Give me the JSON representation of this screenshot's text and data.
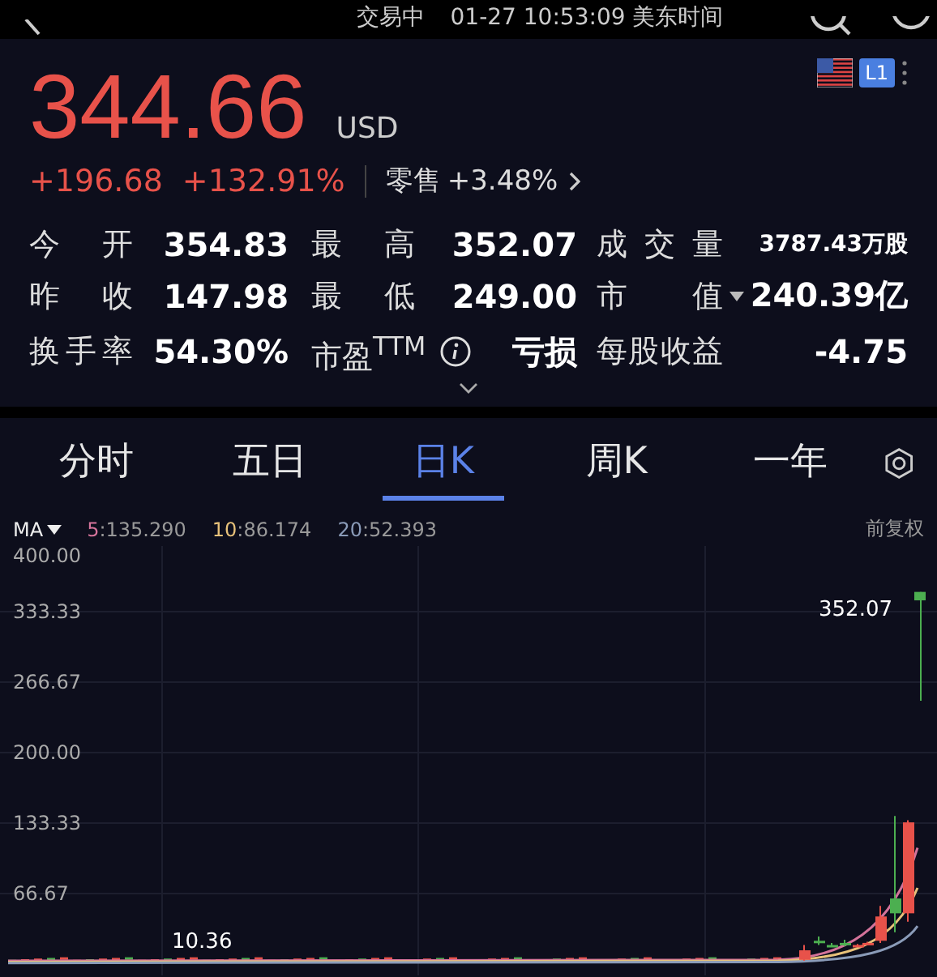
{
  "status_bar": {
    "state": "交易中",
    "time": "01-27 10:53:09 美东时间"
  },
  "quote": {
    "price": "344.66",
    "currency": "USD",
    "change": "+196.68",
    "change_pct": "+132.91%",
    "retail_label": "零售",
    "retail_change": "+3.48%",
    "badge": "L1"
  },
  "stats": [
    [
      {
        "label": "今开",
        "value": "354.83"
      },
      {
        "label": "最高",
        "value": "352.07"
      },
      {
        "label": "成交量",
        "value": "3787.43万股",
        "small": true
      }
    ],
    [
      {
        "label": "昨收",
        "value": "147.98"
      },
      {
        "label": "最低",
        "value": "249.00"
      },
      {
        "label": "市值",
        "value": "240.39亿",
        "dropdown": true
      }
    ],
    [
      {
        "label": "换手率",
        "value": "54.30%"
      },
      {
        "label": "市盈$^{TTM}$",
        "value": "亏损",
        "info": true
      },
      {
        "label": "每股收益",
        "value": "-4.75"
      }
    ]
  ],
  "tabs": [
    {
      "label": "分时",
      "selected": false
    },
    {
      "label": "五日",
      "selected": false
    },
    {
      "label": "日K",
      "selected": true
    },
    {
      "label": "周K",
      "selected": false
    },
    {
      "label": "一年",
      "selected": false
    }
  ],
  "indicator": {
    "label": "MA",
    "items": [
      {
        "period": "5",
        "value": ":135.290",
        "color": "#d4739a"
      },
      {
        "period": "10",
        "value": ":86.174",
        "color": "#e8c27a"
      },
      {
        "period": "20",
        "value": ":52.393",
        "color": "#8a9bb8"
      }
    ],
    "adjust": "前复权"
  },
  "chart": {
    "y_labels": [
      "400.00",
      "333.33",
      "266.67",
      "200.00",
      "133.33",
      "66.67"
    ],
    "high_label": "352.07",
    "low_label": "10.36"
  }
}
